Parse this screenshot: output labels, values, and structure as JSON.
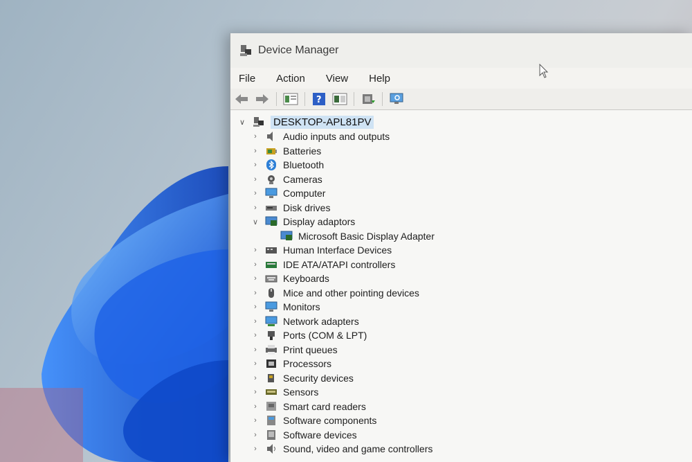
{
  "window": {
    "title": "Device Manager"
  },
  "menu": [
    "File",
    "Action",
    "View",
    "Help"
  ],
  "toolbar": {
    "buttons": [
      "back-arrow-icon",
      "forward-arrow-icon",
      "properties-icon",
      "help-icon",
      "console-tree-icon",
      "update-driver-icon",
      "scan-hardware-icon"
    ]
  },
  "tree": {
    "root": "DESKTOP-APL81PV",
    "categories": [
      {
        "label": "Audio inputs and outputs",
        "expanded": false,
        "icon": "speaker-icon"
      },
      {
        "label": "Batteries",
        "expanded": false,
        "icon": "battery-icon"
      },
      {
        "label": "Bluetooth",
        "expanded": false,
        "icon": "bluetooth-icon"
      },
      {
        "label": "Cameras",
        "expanded": false,
        "icon": "camera-icon"
      },
      {
        "label": "Computer",
        "expanded": false,
        "icon": "monitor-icon"
      },
      {
        "label": "Disk drives",
        "expanded": false,
        "icon": "disk-icon"
      },
      {
        "label": "Display adaptors",
        "expanded": true,
        "icon": "display-adapter-icon",
        "children": [
          "Microsoft Basic Display Adapter"
        ]
      },
      {
        "label": "Human Interface Devices",
        "expanded": false,
        "icon": "hid-icon"
      },
      {
        "label": "IDE ATA/ATAPI controllers",
        "expanded": false,
        "icon": "ide-icon"
      },
      {
        "label": "Keyboards",
        "expanded": false,
        "icon": "keyboard-icon"
      },
      {
        "label": "Mice and other pointing devices",
        "expanded": false,
        "icon": "mouse-icon"
      },
      {
        "label": "Monitors",
        "expanded": false,
        "icon": "monitor-icon"
      },
      {
        "label": "Network adapters",
        "expanded": false,
        "icon": "network-icon"
      },
      {
        "label": "Ports (COM & LPT)",
        "expanded": false,
        "icon": "port-icon"
      },
      {
        "label": "Print queues",
        "expanded": false,
        "icon": "printer-icon"
      },
      {
        "label": "Processors",
        "expanded": false,
        "icon": "processor-icon"
      },
      {
        "label": "Security devices",
        "expanded": false,
        "icon": "security-icon"
      },
      {
        "label": "Sensors",
        "expanded": false,
        "icon": "sensor-icon"
      },
      {
        "label": "Smart card readers",
        "expanded": false,
        "icon": "smart-card-icon"
      },
      {
        "label": "Software components",
        "expanded": false,
        "icon": "software-component-icon"
      },
      {
        "label": "Software devices",
        "expanded": false,
        "icon": "software-device-icon"
      },
      {
        "label": "Sound, video and game controllers",
        "expanded": false,
        "icon": "sound-icon"
      }
    ]
  },
  "colors": {
    "selection": "#cfe3f4",
    "accent": "#2d7fd6",
    "wallpaper": "#2a6fe0"
  }
}
